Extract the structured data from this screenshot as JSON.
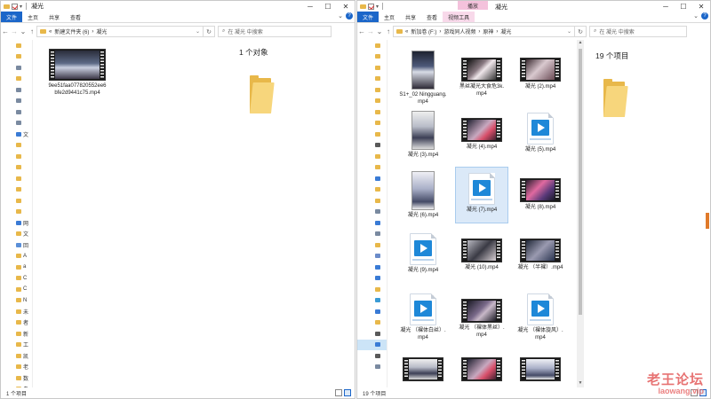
{
  "left_window": {
    "title": "凝光",
    "ribbon_tabs": [
      "文件",
      "主页",
      "共享",
      "查看"
    ],
    "address_segments": [
      "«",
      "新建文件夹 (6)",
      "›",
      "凝光"
    ],
    "search_placeholder": "在 凝光 中搜索",
    "item_count_text": "1 个对象",
    "file": {
      "name": "9ee51faa077820552ee6bfe2d9441c75.mp4"
    },
    "status": "1 个项目"
  },
  "right_window": {
    "title": "凝光",
    "context_group": "播放",
    "ribbon_tabs": [
      "文件",
      "主页",
      "共享",
      "查看",
      "视频工具"
    ],
    "address_segments": [
      "«",
      "新加卷 (F:)",
      "›",
      "游戏同人视频",
      "›",
      "原神",
      "›",
      "凝光"
    ],
    "search_placeholder": "在 凝光 中搜索",
    "item_count_text": "19 个项目",
    "status": "19 个项目",
    "files": [
      {
        "name": "S1+_02 Ningguang.mp4",
        "thumb": "portrait"
      },
      {
        "name": "黑丝凝光大食危3k.mp4",
        "thumb": "film"
      },
      {
        "name": "凝光 (2).mp4",
        "thumb": "film"
      },
      {
        "name": "凝光 (3).mp4",
        "thumb": "portrait"
      },
      {
        "name": "凝光 (4).mp4",
        "thumb": "film"
      },
      {
        "name": "凝光 (5).mp4",
        "thumb": "video-icon"
      },
      {
        "name": "凝光 (6).mp4",
        "thumb": "portrait"
      },
      {
        "name": "凝光 (7).mp4",
        "thumb": "video-icon"
      },
      {
        "name": "凝光 (8).mp4",
        "thumb": "film"
      },
      {
        "name": "凝光 (9).mp4",
        "thumb": "video-icon"
      },
      {
        "name": "凝光 (10).mp4",
        "thumb": "film"
      },
      {
        "name": "凝光 （半裸）.mp4",
        "thumb": "film"
      },
      {
        "name": "凝光 （裸体白丝）.mp4",
        "thumb": "video-icon"
      },
      {
        "name": "凝光 （裸体黑丝）.mp4",
        "thumb": "film"
      },
      {
        "name": "凝光 （裸体旋风）.mp4",
        "thumb": "video-icon"
      }
    ]
  },
  "left_nav_labels": [
    "",
    "",
    "",
    "",
    "",
    "",
    "",
    "",
    "",
    "",
    "",
    "",
    "",
    "",
    "",
    "",
    "",
    "",
    "",
    "",
    "",
    "",
    "",
    "",
    "",
    "",
    "",
    "",
    "",
    "",
    ""
  ],
  "left_nav_visible": [
    "",
    "",
    "",
    "",
    "",
    "",
    "",
    "",
    "文",
    "",
    "",
    "",
    "",
    "",
    "",
    "",
    "网",
    "文",
    "回",
    "A",
    "a",
    "C",
    "C",
    "N",
    "未",
    "者",
    "新",
    "工",
    "凯",
    "老",
    "数",
    "自",
    "数",
    "数"
  ],
  "right_nav_visible": [
    "",
    "",
    "",
    "",
    "",
    "",
    "",
    "",
    "",
    "",
    "",
    "",
    "",
    "",
    "",
    "",
    "",
    "",
    "",
    "",
    "",
    "",
    "",
    "",
    "",
    "",
    "",
    "",
    "",
    "",
    "",
    "",
    "",
    "",
    ""
  ],
  "watermark": {
    "line1": "老王论坛",
    "line2": "laowang.vip"
  },
  "colors": {
    "accent": "#1b66c9",
    "folder": "#e8b84a",
    "context_tab": "#f4c2dc",
    "selection": "#dbe9f8"
  }
}
